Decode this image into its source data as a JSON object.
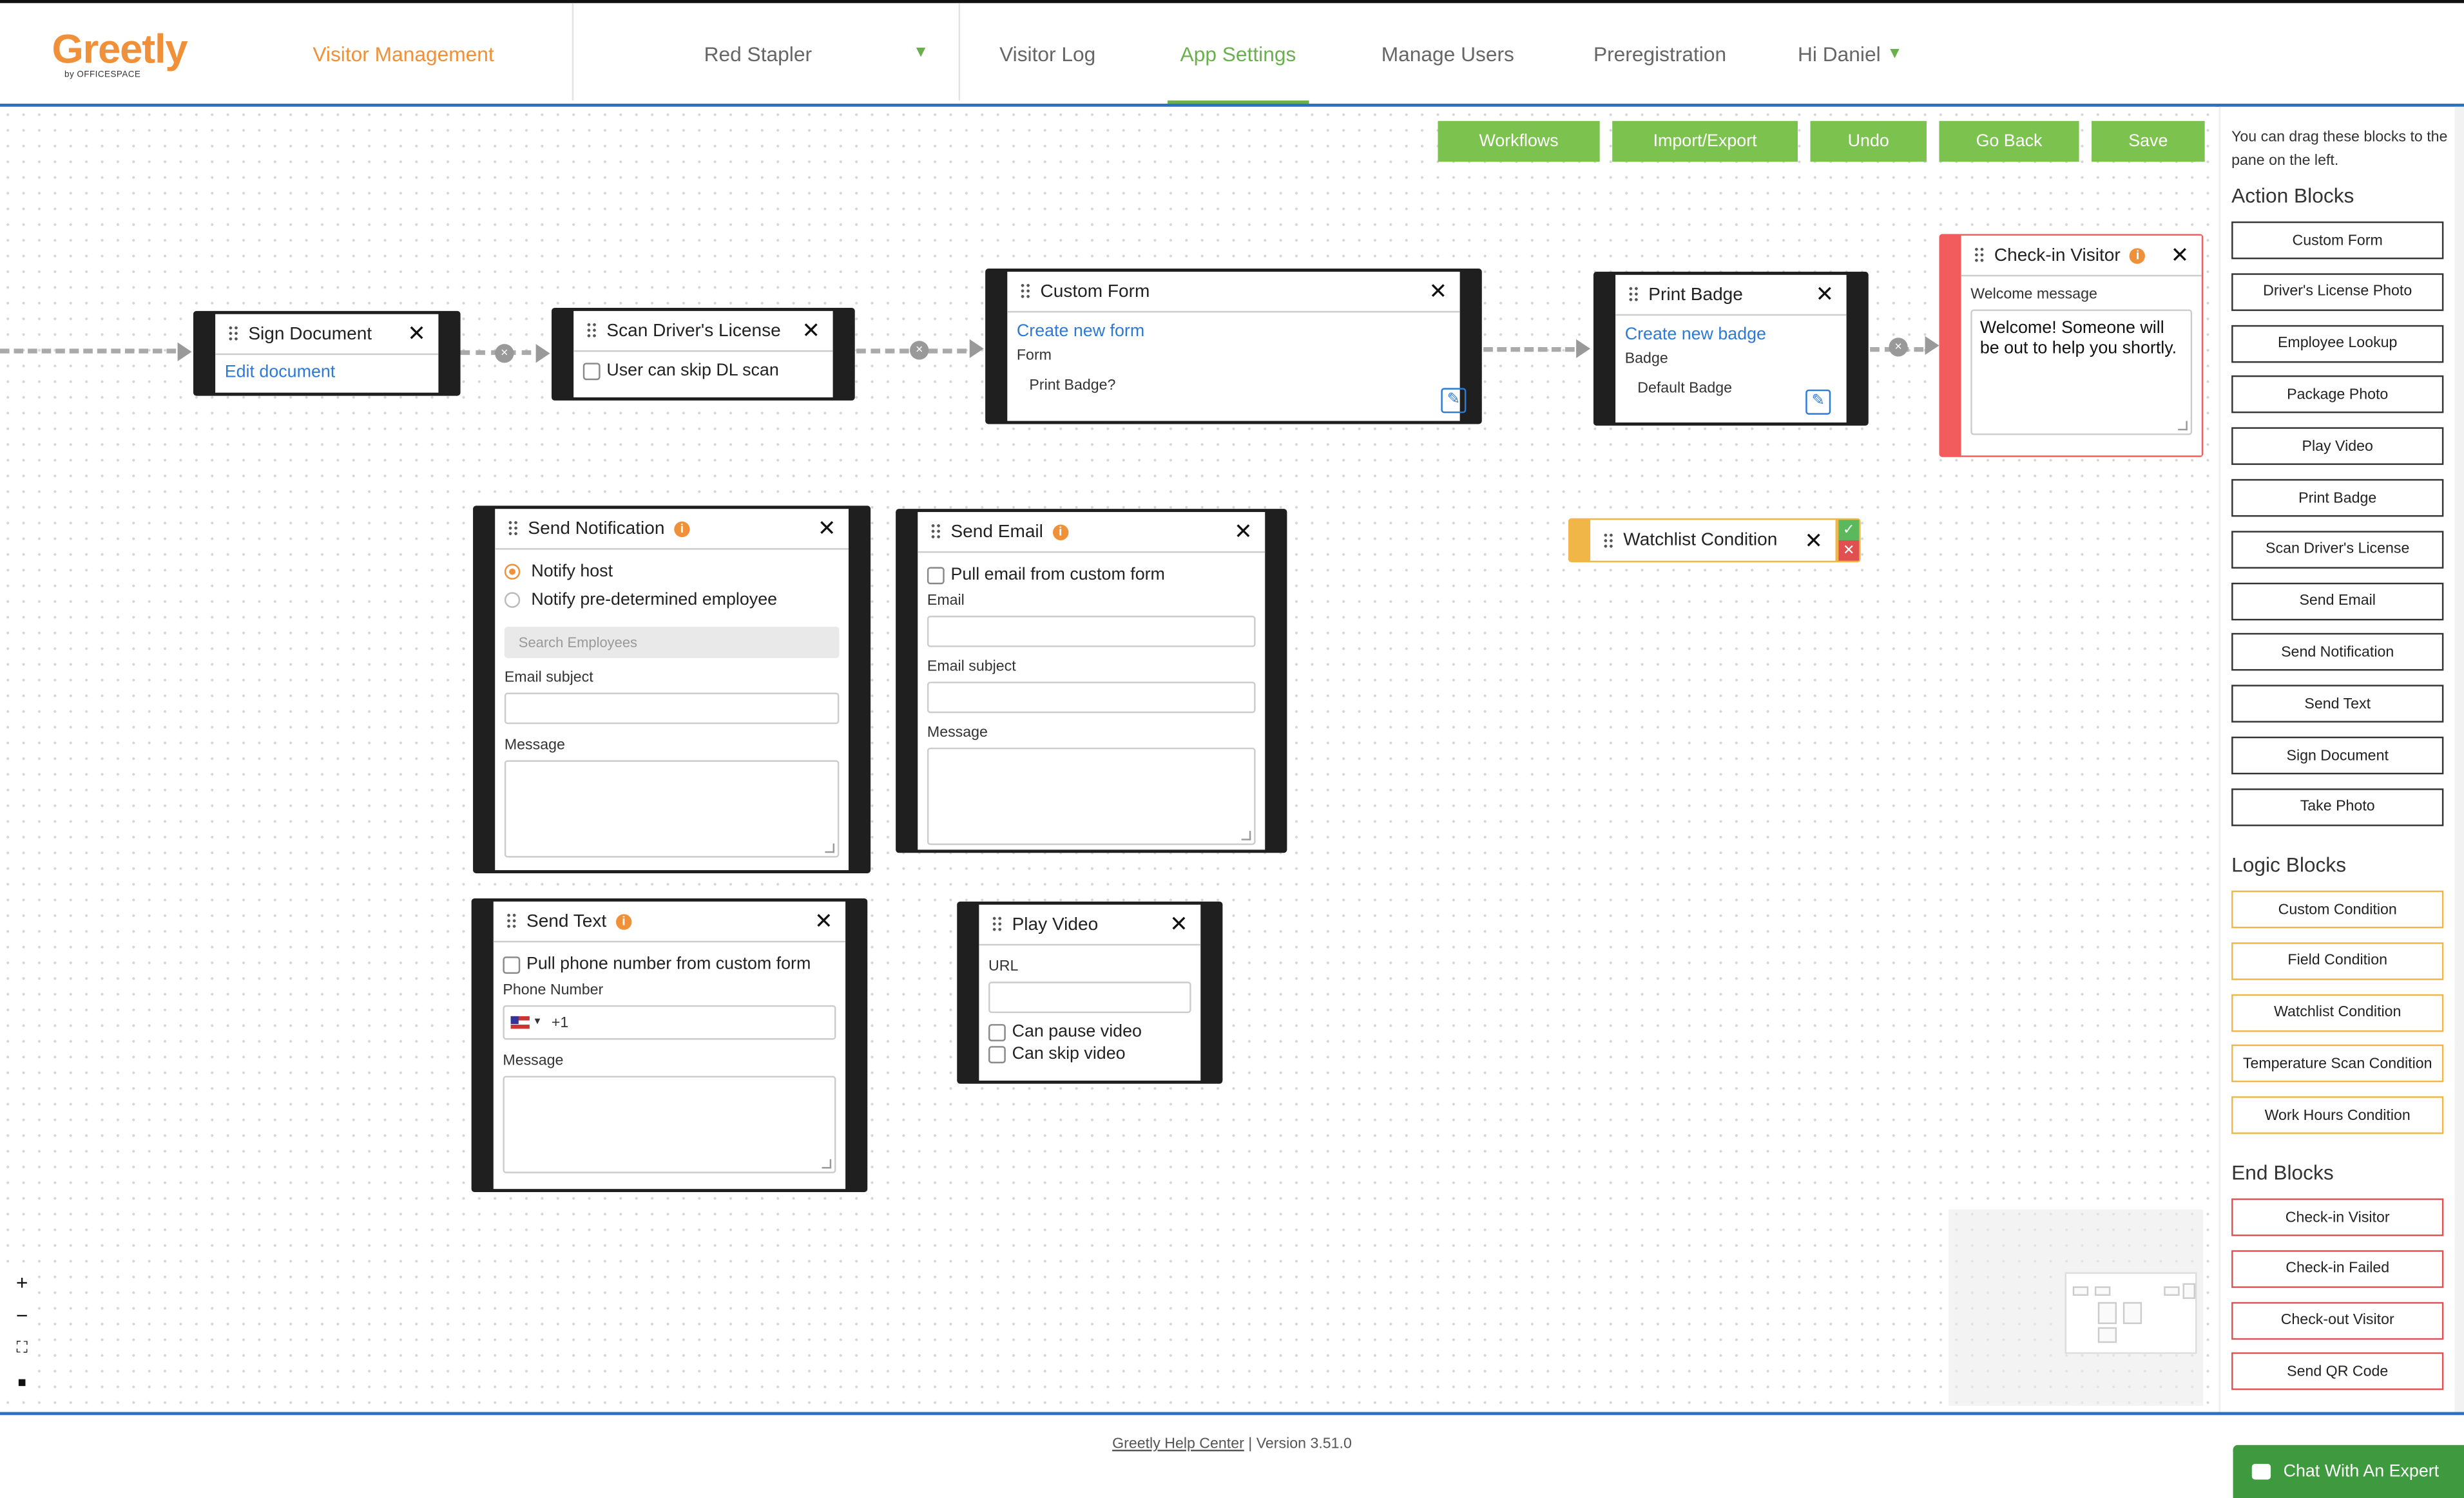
{
  "header": {
    "logo_text": "Greetly",
    "logo_sub": "by OFFICESPACE",
    "nav": {
      "visitor_management": "Visitor Management",
      "location": "Red Stapler",
      "visitor_log": "Visitor Log",
      "app_settings": "App Settings",
      "manage_users": "Manage Users",
      "preregistration": "Preregistration",
      "user": "Hi Daniel"
    }
  },
  "toolbar": {
    "workflows": "Workflows",
    "import_export": "Import/Export",
    "undo": "Undo",
    "go_back": "Go Back",
    "save": "Save"
  },
  "blocks": {
    "sign_document": {
      "title": "Sign Document",
      "link": "Edit document"
    },
    "scan_dl": {
      "title": "Scan Driver's License",
      "option": "User can skip DL scan"
    },
    "custom_form": {
      "title": "Custom Form",
      "link": "Create new form",
      "label": "Form",
      "value": "Print Badge?"
    },
    "print_badge": {
      "title": "Print Badge",
      "link": "Create new badge",
      "label": "Badge",
      "value": "Default Badge"
    },
    "checkin_visitor": {
      "title": "Check-in Visitor",
      "label": "Welcome message",
      "message": "Welcome! Someone will be out to help you shortly."
    },
    "send_notification": {
      "title": "Send Notification",
      "opt_host": "Notify host",
      "opt_employee": "Notify pre-determined employee",
      "search_placeholder": "Search Employees",
      "subject_label": "Email subject",
      "message_label": "Message"
    },
    "send_email": {
      "title": "Send Email",
      "option": "Pull email from custom form",
      "email_label": "Email",
      "subject_label": "Email subject",
      "message_label": "Message"
    },
    "watchlist": {
      "title": "Watchlist Condition"
    },
    "send_text": {
      "title": "Send Text",
      "option": "Pull phone number from custom form",
      "phone_label": "Phone Number",
      "phone_prefix": "+1",
      "message_label": "Message"
    },
    "play_video": {
      "title": "Play Video",
      "url_label": "URL",
      "opt_pause": "Can pause video",
      "opt_skip": "Can skip video"
    }
  },
  "panel": {
    "note": "You can drag these blocks to the pane on the left.",
    "action_title": "Action Blocks",
    "action_blocks": [
      "Custom Form",
      "Driver's License Photo",
      "Employee Lookup",
      "Package Photo",
      "Play Video",
      "Print Badge",
      "Scan Driver's License",
      "Send Email",
      "Send Notification",
      "Send Text",
      "Sign Document",
      "Take Photo"
    ],
    "logic_title": "Logic Blocks",
    "logic_blocks": [
      "Custom Condition",
      "Field Condition",
      "Watchlist Condition",
      "Temperature Scan Condition",
      "Work Hours Condition"
    ],
    "end_title": "End Blocks",
    "end_blocks": [
      "Check-in Visitor",
      "Check-in Failed",
      "Check-out Visitor",
      "Send QR Code"
    ]
  },
  "footer": {
    "help_link": "Greetly Help Center",
    "version": " | Version 3.51.0",
    "chat": "Chat With An Expert"
  },
  "colors": {
    "brand_orange": "#f0913a",
    "green": "#7cc24f",
    "blue": "#2d6fc4",
    "end_red": "#e05050",
    "logic_yellow": "#f0b648"
  }
}
